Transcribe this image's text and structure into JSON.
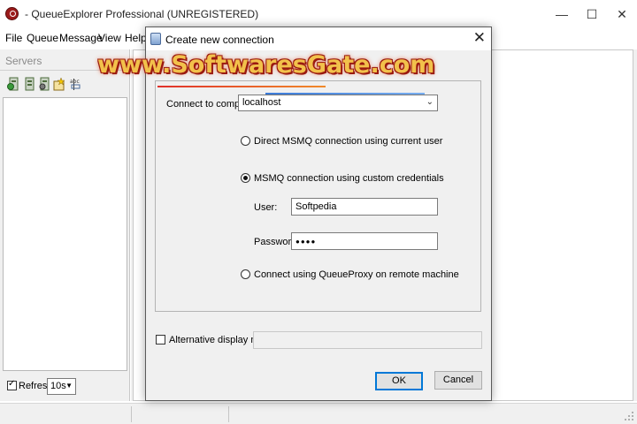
{
  "window": {
    "title": "- QueueExplorer Professional (UNREGISTERED)",
    "minimize_icon": "minimize-icon",
    "maximize_icon": "maximize-icon",
    "close_icon": "close-icon"
  },
  "menu": {
    "items": [
      "File",
      "Queue",
      "Message",
      "View",
      "Help"
    ]
  },
  "left_pane": {
    "header": "Servers",
    "toolbar_icons": [
      "add-server-icon",
      "server-icon",
      "server-settings-icon",
      "new-item-icon",
      "rename-icon"
    ],
    "refresh_label": "Refresh",
    "refresh_checked": true,
    "refresh_interval": "10s"
  },
  "dialog": {
    "title": "Create new connection",
    "close_icon": "close-icon",
    "connect_label": "Connect to computer:",
    "computer_value": "localhost",
    "options": [
      {
        "label": "Direct MSMQ connection using current user",
        "checked": false
      },
      {
        "label": "MSMQ connection using custom credentials",
        "checked": true
      },
      {
        "label": "Connect using QueueProxy on remote machine",
        "checked": false
      }
    ],
    "user_label": "User:",
    "user_value": "Softpedia",
    "password_label": "Password:",
    "password_value": "●●●●",
    "alt_name_label": "Alternative display name:",
    "alt_name_checked": false,
    "alt_name_value": "",
    "ok_label": "OK",
    "cancel_label": "Cancel"
  },
  "watermark": {
    "text": "www.SoftwaresGate.com"
  },
  "colors": {
    "accent": "#0078d7",
    "watermark_fill": "#f2c14b",
    "watermark_outline": "#9a1a10"
  }
}
